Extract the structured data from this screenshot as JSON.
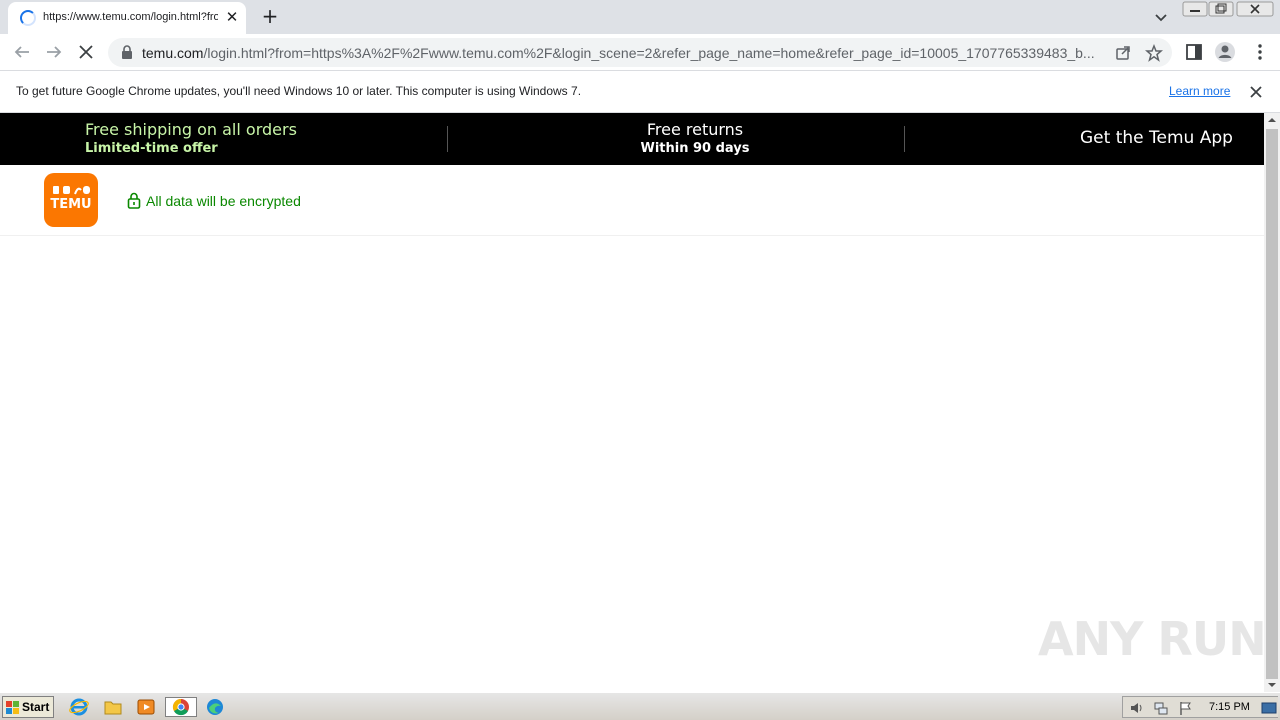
{
  "browser": {
    "tab": {
      "title": "https://www.temu.com/login.html?from=https%3A%2F%2Fwww.temu.com%2F",
      "status": "loading"
    },
    "url": {
      "host": "temu.com",
      "path": "/login.html?from=https%3A%2F%2Fwww.temu.com%2F&login_scene=2&refer_page_name=home&refer_page_id=10005_1707765339483_b..."
    },
    "infobar": {
      "message": "To get future Google Chrome updates, you'll need Windows 10 or later. This computer is using Windows 7.",
      "link": "Learn more"
    }
  },
  "page": {
    "promo": {
      "shipping_title": "Free shipping on all orders",
      "shipping_sub": "Limited-time offer",
      "returns_title": "Free returns",
      "returns_sub": "Within 90 days",
      "app_cta": "Get the Temu App"
    },
    "header": {
      "logo_text": "TEMU",
      "secure_text": "All data will be encrypted"
    }
  },
  "watermark": "ANY RUN",
  "taskbar": {
    "start_label": "Start",
    "clock": "7:15 PM"
  },
  "colors": {
    "promo_bg": "#000000",
    "promo_accent": "#c8f5a8",
    "brand": "#fb7701",
    "secure_green": "#0a8800",
    "chrome_frame": "#dee1e6"
  }
}
